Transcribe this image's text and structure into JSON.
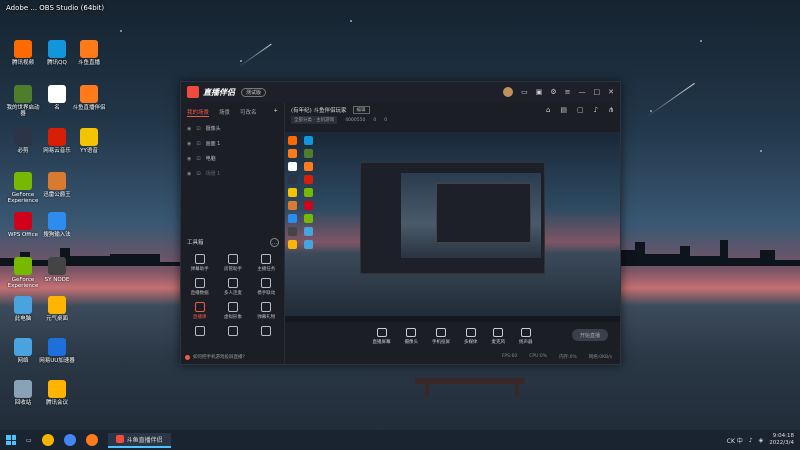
{
  "desktop": {
    "banner": "Adobe ... OBS Studio (64bit)",
    "icons": [
      {
        "label": "腾讯视频",
        "color": "#ff6a00"
      },
      {
        "label": "腾讯QQ",
        "color": "#1296db"
      },
      {
        "label": "斗鱼直播",
        "color": "#ff7a1a"
      },
      {
        "label": "我的世界启动器",
        "color": "#4e7d2c"
      },
      {
        "label": "名",
        "color": "#ffffff"
      },
      {
        "label": "斗鱼直播伴侣",
        "color": "#ff7a1a"
      },
      {
        "label": "必剪",
        "color": "#2d3447"
      },
      {
        "label": "网易云音乐",
        "color": "#d81e06"
      },
      {
        "label": "YY语音",
        "color": "#f5c400"
      },
      {
        "label": "GeForce Experience",
        "color": "#76b900"
      },
      {
        "label": "迅雷公爵王",
        "color": "#d97b2e"
      },
      {
        "label": "WPS Office",
        "color": "#d0021b"
      },
      {
        "label": "搜狗输入法",
        "color": "#2d8cf0"
      },
      {
        "label": "GeForce Experience",
        "color": "#76b900"
      },
      {
        "label": "SY NODE",
        "color": "#444"
      },
      {
        "label": "此电脑",
        "color": "#4aa3df"
      },
      {
        "label": "元气桌面",
        "color": "#ffb400"
      },
      {
        "label": "网络",
        "color": "#4aa3df"
      },
      {
        "label": "网易UU加速器",
        "color": "#1e6fd9"
      },
      {
        "label": "回收站",
        "color": "#8aa2b6"
      },
      {
        "label": "腾讯会议",
        "color": "#ffb400"
      }
    ]
  },
  "app": {
    "title": "直播伴侣",
    "version": "测试版",
    "sidebar": {
      "tabs": [
        "我的场景",
        "场景",
        "可改名"
      ],
      "add_label": "+",
      "scenes": [
        "摄像头",
        "画面 1",
        "电脑",
        "场景 1"
      ],
      "tools_title": "工具箱",
      "tools": [
        {
          "label": "弹幕助手",
          "hot": false
        },
        {
          "label": "房管助手",
          "hot": false
        },
        {
          "label": "主播任务",
          "hot": false
        },
        {
          "label": "直播数据",
          "hot": false
        },
        {
          "label": "多人连麦",
          "hot": false
        },
        {
          "label": "携手联动",
          "hot": false
        },
        {
          "label": "直播课",
          "hot": true
        },
        {
          "label": "虚拟形象",
          "hot": false
        },
        {
          "label": "弹幕礼物",
          "hot": false
        },
        {
          "label": "",
          "hot": false
        },
        {
          "label": "",
          "hot": false
        },
        {
          "label": "",
          "hot": false
        }
      ],
      "footer": "如何把手机游戏投屏直播？"
    },
    "header": {
      "room_title": "(有年纪) 斗鱼伴侣玩家",
      "edit_label": "编辑",
      "category": "全部分类 · 主机游戏",
      "room_id": "4000550",
      "fans": "0",
      "likes": "0"
    },
    "controls": [
      {
        "label": "直播屏幕"
      },
      {
        "label": "摄像头"
      },
      {
        "label": "手机投屏"
      },
      {
        "label": "多媒体"
      },
      {
        "label": "麦克风"
      },
      {
        "label": "扬声器"
      }
    ],
    "start_live": "开始直播",
    "stats": [
      "FPS:60",
      "CPU:0%",
      "内存:0%",
      "网络:0KB/s"
    ]
  },
  "taskbar": {
    "active_app": "斗鱼直播伴侣",
    "time": "9:04:18",
    "date": "2022/3/4",
    "tray_text": "CK 中"
  }
}
